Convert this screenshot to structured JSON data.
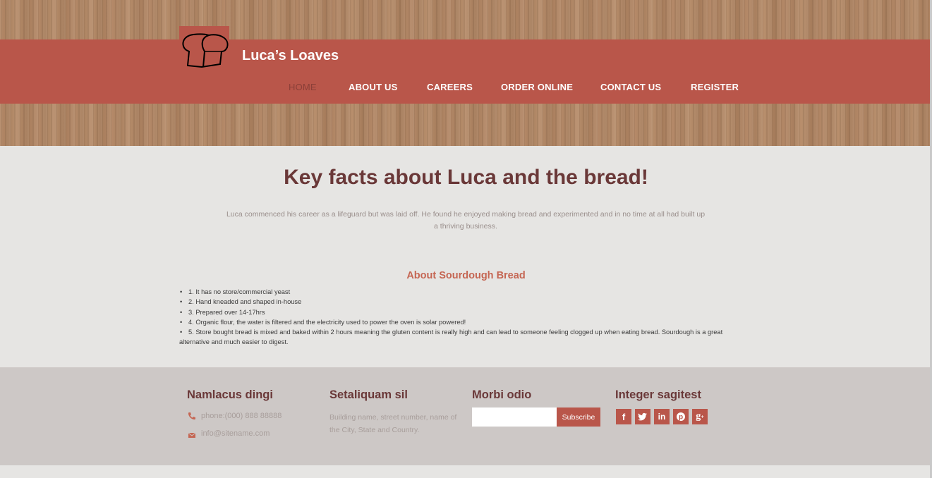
{
  "brand": {
    "name": "Luca’s Loaves"
  },
  "nav": {
    "items": [
      {
        "label": "HOME",
        "active": true
      },
      {
        "label": "ABOUT US",
        "active": false
      },
      {
        "label": "CAREERS",
        "active": false
      },
      {
        "label": "ORDER ONLINE",
        "active": false
      },
      {
        "label": "CONTACT US",
        "active": false
      },
      {
        "label": "REGISTER",
        "active": false
      }
    ]
  },
  "main": {
    "title": "Key facts about Luca and the bread!",
    "intro": "Luca commenced his career as a lifeguard but was laid off. He found he enjoyed making bread and experimented and in no time at all had built up a thriving business.",
    "subtitle": "About Sourdough Bread",
    "facts": [
      "1. It has no store/commercial yeast",
      "2. Hand kneaded and shaped in-house",
      "3. Prepared over 14-17hrs",
      "4. Organic flour, the water is filtered and the electricity used to power the oven is solar powered!",
      "5. Store bought bread is mixed and baked within 2 hours meaning the gluten content is really high and can lead to someone feeling clogged up when eating bread. Sourdough is a great alternative and much easier to digest."
    ]
  },
  "footer": {
    "col1": {
      "title": "Namlacus dingi",
      "phone": "phone:(000) 888 88888",
      "email": "info@sitename.com"
    },
    "col2": {
      "title": "Setaliquam sil",
      "address": "Building name, street number, name of the City, State and Country."
    },
    "col3": {
      "title": "Morbi odio",
      "button": "Subscribe",
      "input_value": ""
    },
    "col4": {
      "title": "Integer sagitest",
      "social": [
        "facebook-icon",
        "twitter-icon",
        "linkedin-icon",
        "pinterest-icon",
        "google-plus-icon"
      ]
    }
  },
  "colors": {
    "accent": "#b9564a",
    "title": "#6a3838",
    "subtitle": "#c56653"
  }
}
